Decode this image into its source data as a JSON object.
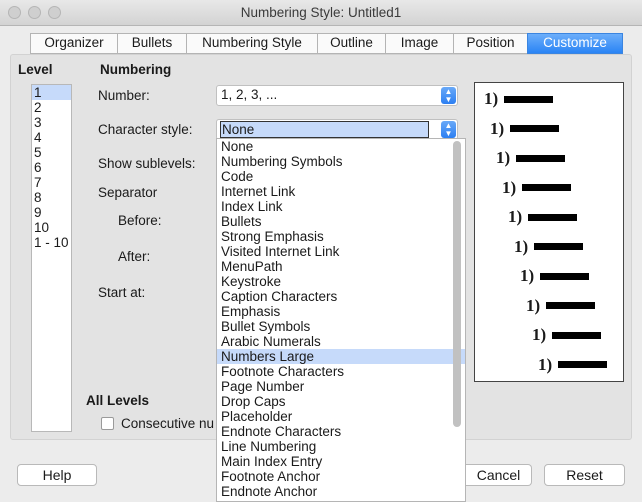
{
  "window": {
    "title": "Numbering Style: Untitled1"
  },
  "tabs": [
    "Organizer",
    "Bullets",
    "Numbering Style",
    "Outline",
    "Image",
    "Position",
    "Customize"
  ],
  "level": {
    "heading": "Level",
    "items": [
      "1",
      "2",
      "3",
      "4",
      "5",
      "6",
      "7",
      "8",
      "9",
      "10",
      "1 - 10"
    ],
    "selected": "1"
  },
  "numbering": {
    "heading": "Numbering",
    "number_label": "Number:",
    "number_value": "1, 2, 3, ...",
    "char_style_label": "Character style:",
    "char_style_value": "None",
    "show_sublevels_label": "Show sublevels:",
    "separator_label": "Separator",
    "before_label": "Before:",
    "after_label": "After:",
    "start_at_label": "Start at:"
  },
  "dropdown": {
    "options": [
      "None",
      "Numbering Symbols",
      "Code",
      "Internet Link",
      "Index Link",
      "Bullets",
      "Strong Emphasis",
      "Visited Internet Link",
      "MenuPath",
      "Keystroke",
      "Caption Characters",
      "Emphasis",
      "Bullet Symbols",
      "Arabic Numerals",
      "Numbers Large",
      "Footnote Characters",
      "Page Number",
      "Drop Caps",
      "Placeholder",
      "Endnote Characters",
      "Line Numbering",
      "Main Index Entry",
      "Footnote Anchor",
      "Endnote Anchor"
    ],
    "highlighted": "Numbers Large"
  },
  "preview": {
    "items": [
      "1)",
      "1)",
      "1)",
      "1)",
      "1)",
      "1)",
      "1)",
      "1)",
      "1)",
      "1)"
    ]
  },
  "all_levels": {
    "heading": "All Levels",
    "consecutive_label": "Consecutive nu"
  },
  "buttons": {
    "help": "Help",
    "cancel": "Cancel",
    "reset": "Reset"
  },
  "colors": {
    "accent": "#2a84f5",
    "selection": "#c6dafa"
  }
}
